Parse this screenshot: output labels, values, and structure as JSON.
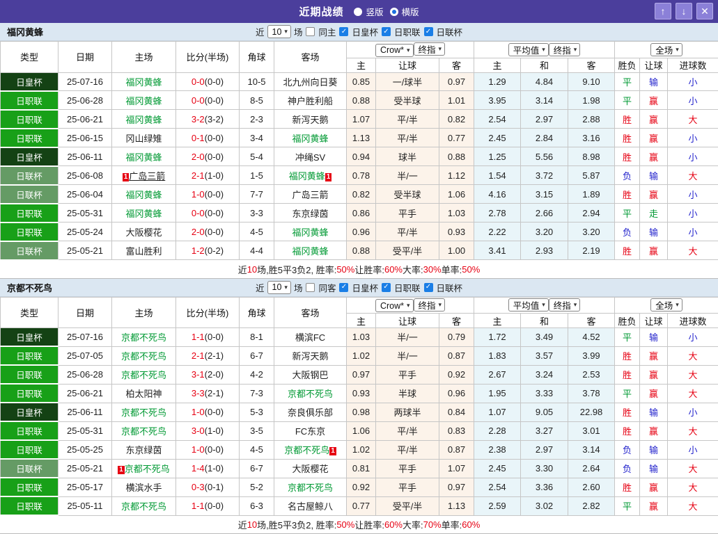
{
  "titlebar": {
    "title": "近期战绩",
    "vertical_label": "竖版",
    "horizontal_label": "横版",
    "selected_layout": "横版"
  },
  "icons": {
    "up": "↑",
    "down": "↓",
    "close": "✕",
    "check": "✓",
    "dropdown": "▾",
    "badge": "1"
  },
  "colors": {
    "titlebar_purple": "#4b3e9c",
    "cup_royal_green": "#144214",
    "league_green": "#18a018",
    "league_cup_green": "#659b65",
    "team_green": "#009933",
    "score_red": "#e60012",
    "lose_blue": "#2222cc"
  },
  "table_header": {
    "cols": [
      "类型",
      "日期",
      "主场",
      "比分(半场)",
      "角球",
      "客场"
    ],
    "group1_selects": [
      "Crow*",
      "终指"
    ],
    "group1_cols": [
      "主",
      "让球",
      "客"
    ],
    "group2_selects": [
      "平均值",
      "终指"
    ],
    "group2_cols": [
      "主",
      "和",
      "客"
    ],
    "group3_selects": [
      "全场"
    ],
    "group3_cols": [
      "胜负",
      "让球",
      "进球数"
    ]
  },
  "sections": [
    {
      "team": "福冈黄蜂",
      "filters": {
        "prefix": "近",
        "count": "10",
        "suffix": "场",
        "same_label": "同主",
        "same_checked": false,
        "cups": [
          {
            "label": "日皇杯",
            "checked": true
          },
          {
            "label": "日职联",
            "checked": true
          },
          {
            "label": "日联杯",
            "checked": true
          }
        ]
      },
      "rows": [
        {
          "type": "日皇杯",
          "tc": "royal",
          "date": "25-07-16",
          "home": "福冈黄蜂",
          "hg": true,
          "score": "0-0",
          "half": "(0-0)",
          "corner": "10-5",
          "away": "北九州向日葵",
          "o1": "0.85",
          "hcap": "一/球半",
          "o2": "0.97",
          "a1": "1.29",
          "a2": "4.84",
          "a3": "9.10",
          "r1": "平",
          "r1c": "g",
          "r2": "输",
          "r2c": "b",
          "r3": "小",
          "r3c": "b"
        },
        {
          "type": "日职联",
          "tc": "jl",
          "date": "25-06-28",
          "home": "福冈黄蜂",
          "hg": true,
          "score": "0-0",
          "half": "(0-0)",
          "corner": "8-5",
          "away": "神户胜利船",
          "o1": "0.88",
          "hcap": "受半球",
          "o2": "1.01",
          "a1": "3.95",
          "a2": "3.14",
          "a3": "1.98",
          "r1": "平",
          "r1c": "g",
          "r2": "赢",
          "r2c": "r",
          "r3": "小",
          "r3c": "b"
        },
        {
          "type": "日职联",
          "tc": "jl",
          "date": "25-06-21",
          "home": "福冈黄蜂",
          "hg": true,
          "score": "3-2",
          "half": "(3-2)",
          "corner": "2-3",
          "away": "新泻天鹅",
          "o1": "1.07",
          "hcap": "平/半",
          "o2": "0.82",
          "a1": "2.54",
          "a2": "2.97",
          "a3": "2.88",
          "r1": "胜",
          "r1c": "r",
          "r2": "赢",
          "r2c": "r",
          "r3": "大",
          "r3c": "r"
        },
        {
          "type": "日职联",
          "tc": "jl",
          "date": "25-06-15",
          "home": "冈山绿雉",
          "score": "0-1",
          "half": "(0-0)",
          "corner": "3-4",
          "away": "福冈黄蜂",
          "ag": true,
          "o1": "1.13",
          "hcap": "平/半",
          "o2": "0.77",
          "a1": "2.45",
          "a2": "2.84",
          "a3": "3.16",
          "r1": "胜",
          "r1c": "r",
          "r2": "赢",
          "r2c": "r",
          "r3": "小",
          "r3c": "b"
        },
        {
          "type": "日皇杯",
          "tc": "royal",
          "date": "25-06-11",
          "home": "福冈黄蜂",
          "hg": true,
          "score": "2-0",
          "half": "(0-0)",
          "corner": "5-4",
          "away": "冲绳SV",
          "o1": "0.94",
          "hcap": "球半",
          "o2": "0.88",
          "a1": "1.25",
          "a2": "5.56",
          "a3": "8.98",
          "r1": "胜",
          "r1c": "r",
          "r2": "赢",
          "r2c": "r",
          "r3": "小",
          "r3c": "b"
        },
        {
          "type": "日联杯",
          "tc": "lc",
          "date": "25-06-08",
          "home": "广岛三箭",
          "hb": true,
          "hu": true,
          "score": "2-1",
          "half": "(1-0)",
          "corner": "1-5",
          "away": "福冈黄蜂",
          "ag": true,
          "ab": true,
          "o1": "0.78",
          "hcap": "半/一",
          "o2": "1.12",
          "a1": "1.54",
          "a2": "3.72",
          "a3": "5.87",
          "r1": "负",
          "r1c": "b",
          "r2": "输",
          "r2c": "b",
          "r3": "大",
          "r3c": "r"
        },
        {
          "type": "日联杯",
          "tc": "lc",
          "date": "25-06-04",
          "home": "福冈黄蜂",
          "hg": true,
          "score": "1-0",
          "half": "(0-0)",
          "corner": "7-7",
          "away": "广岛三箭",
          "o1": "0.82",
          "hcap": "受半球",
          "o2": "1.06",
          "a1": "4.16",
          "a2": "3.15",
          "a3": "1.89",
          "r1": "胜",
          "r1c": "r",
          "r2": "赢",
          "r2c": "r",
          "r3": "小",
          "r3c": "b"
        },
        {
          "type": "日职联",
          "tc": "jl",
          "date": "25-05-31",
          "home": "福冈黄蜂",
          "hg": true,
          "score": "0-0",
          "half": "(0-0)",
          "corner": "3-3",
          "away": "东京绿茵",
          "o1": "0.86",
          "hcap": "平手",
          "o2": "1.03",
          "a1": "2.78",
          "a2": "2.66",
          "a3": "2.94",
          "r1": "平",
          "r1c": "g",
          "r2": "走",
          "r2c": "g",
          "r3": "小",
          "r3c": "b"
        },
        {
          "type": "日职联",
          "tc": "jl",
          "date": "25-05-24",
          "home": "大阪樱花",
          "score": "2-0",
          "half": "(0-0)",
          "corner": "4-5",
          "away": "福冈黄蜂",
          "ag": true,
          "o1": "0.96",
          "hcap": "平/半",
          "o2": "0.93",
          "a1": "2.22",
          "a2": "3.20",
          "a3": "3.20",
          "r1": "负",
          "r1c": "b",
          "r2": "输",
          "r2c": "b",
          "r3": "小",
          "r3c": "b"
        },
        {
          "type": "日联杯",
          "tc": "lc",
          "date": "25-05-21",
          "home": "富山胜利",
          "score": "1-2",
          "half": "(0-2)",
          "corner": "4-4",
          "away": "福冈黄蜂",
          "ag": true,
          "o1": "0.88",
          "hcap": "受平/半",
          "o2": "1.00",
          "a1": "3.41",
          "a2": "2.93",
          "a3": "2.19",
          "r1": "胜",
          "r1c": "r",
          "r2": "赢",
          "r2c": "r",
          "r3": "大",
          "r3c": "r"
        }
      ],
      "summary": [
        {
          "t": "近"
        },
        {
          "t": "10",
          "red": true
        },
        {
          "t": "场,胜5平3负2, 胜率:"
        },
        {
          "t": "50%",
          "red": true
        },
        {
          "t": " 让胜率:"
        },
        {
          "t": "60%",
          "red": true
        },
        {
          "t": " 大率:"
        },
        {
          "t": "30%",
          "red": true
        },
        {
          "t": " 单率:"
        },
        {
          "t": "50%",
          "red": true
        }
      ]
    },
    {
      "team": "京都不死鸟",
      "filters": {
        "prefix": "近",
        "count": "10",
        "suffix": "场",
        "same_label": "同客",
        "same_checked": false,
        "cups": [
          {
            "label": "日皇杯",
            "checked": true
          },
          {
            "label": "日职联",
            "checked": true
          },
          {
            "label": "日联杯",
            "checked": true
          }
        ]
      },
      "rows": [
        {
          "type": "日皇杯",
          "tc": "royal",
          "date": "25-07-16",
          "home": "京都不死鸟",
          "hg": true,
          "score": "1-1",
          "half": "(0-0)",
          "corner": "8-1",
          "away": "横滨FC",
          "o1": "1.03",
          "hcap": "半/一",
          "o2": "0.79",
          "a1": "1.72",
          "a2": "3.49",
          "a3": "4.52",
          "r1": "平",
          "r1c": "g",
          "r2": "输",
          "r2c": "b",
          "r3": "小",
          "r3c": "b"
        },
        {
          "type": "日职联",
          "tc": "jl",
          "date": "25-07-05",
          "home": "京都不死鸟",
          "hg": true,
          "score": "2-1",
          "half": "(2-1)",
          "corner": "6-7",
          "away": "新泻天鹅",
          "o1": "1.02",
          "hcap": "半/一",
          "o2": "0.87",
          "a1": "1.83",
          "a2": "3.57",
          "a3": "3.99",
          "r1": "胜",
          "r1c": "r",
          "r2": "赢",
          "r2c": "r",
          "r3": "大",
          "r3c": "r"
        },
        {
          "type": "日职联",
          "tc": "jl",
          "date": "25-06-28",
          "home": "京都不死鸟",
          "hg": true,
          "score": "3-1",
          "half": "(2-0)",
          "corner": "4-2",
          "away": "大阪钢巴",
          "o1": "0.97",
          "hcap": "平手",
          "o2": "0.92",
          "a1": "2.67",
          "a2": "3.24",
          "a3": "2.53",
          "r1": "胜",
          "r1c": "r",
          "r2": "赢",
          "r2c": "r",
          "r3": "大",
          "r3c": "r"
        },
        {
          "type": "日职联",
          "tc": "jl",
          "date": "25-06-21",
          "home": "柏太阳神",
          "score": "3-3",
          "half": "(2-1)",
          "corner": "7-3",
          "away": "京都不死鸟",
          "ag": true,
          "o1": "0.93",
          "hcap": "半球",
          "o2": "0.96",
          "a1": "1.95",
          "a2": "3.33",
          "a3": "3.78",
          "r1": "平",
          "r1c": "g",
          "r2": "赢",
          "r2c": "r",
          "r3": "大",
          "r3c": "r"
        },
        {
          "type": "日皇杯",
          "tc": "royal",
          "date": "25-06-11",
          "home": "京都不死鸟",
          "hg": true,
          "score": "1-0",
          "half": "(0-0)",
          "corner": "5-3",
          "away": "奈良俱乐部",
          "o1": "0.98",
          "hcap": "两球半",
          "o2": "0.84",
          "a1": "1.07",
          "a2": "9.05",
          "a3": "22.98",
          "r1": "胜",
          "r1c": "r",
          "r2": "输",
          "r2c": "b",
          "r3": "小",
          "r3c": "b"
        },
        {
          "type": "日职联",
          "tc": "jl",
          "date": "25-05-31",
          "home": "京都不死鸟",
          "hg": true,
          "score": "3-0",
          "half": "(1-0)",
          "corner": "3-5",
          "away": "FC东京",
          "o1": "1.06",
          "hcap": "平/半",
          "o2": "0.83",
          "a1": "2.28",
          "a2": "3.27",
          "a3": "3.01",
          "r1": "胜",
          "r1c": "r",
          "r2": "赢",
          "r2c": "r",
          "r3": "大",
          "r3c": "r"
        },
        {
          "type": "日职联",
          "tc": "jl",
          "date": "25-05-25",
          "home": "东京绿茵",
          "score": "1-0",
          "half": "(0-0)",
          "corner": "4-5",
          "away": "京都不死鸟",
          "ag": true,
          "ab": true,
          "o1": "1.02",
          "hcap": "平/半",
          "o2": "0.87",
          "a1": "2.38",
          "a2": "2.97",
          "a3": "3.14",
          "r1": "负",
          "r1c": "b",
          "r2": "输",
          "r2c": "b",
          "r3": "小",
          "r3c": "b"
        },
        {
          "type": "日联杯",
          "tc": "lc",
          "date": "25-05-21",
          "home": "京都不死鸟",
          "hg": true,
          "hb": true,
          "score": "1-4",
          "half": "(1-0)",
          "corner": "6-7",
          "away": "大阪樱花",
          "o1": "0.81",
          "hcap": "平手",
          "o2": "1.07",
          "a1": "2.45",
          "a2": "3.30",
          "a3": "2.64",
          "r1": "负",
          "r1c": "b",
          "r2": "输",
          "r2c": "b",
          "r3": "大",
          "r3c": "r"
        },
        {
          "type": "日职联",
          "tc": "jl",
          "date": "25-05-17",
          "home": "横滨水手",
          "score": "0-3",
          "half": "(0-1)",
          "corner": "5-2",
          "away": "京都不死鸟",
          "ag": true,
          "o1": "0.92",
          "hcap": "平手",
          "o2": "0.97",
          "a1": "2.54",
          "a2": "3.36",
          "a3": "2.60",
          "r1": "胜",
          "r1c": "r",
          "r2": "赢",
          "r2c": "r",
          "r3": "大",
          "r3c": "r"
        },
        {
          "type": "日职联",
          "tc": "jl",
          "date": "25-05-11",
          "home": "京都不死鸟",
          "hg": true,
          "score": "1-1",
          "half": "(0-0)",
          "corner": "6-3",
          "away": "名古屋鲸八",
          "o1": "0.77",
          "hcap": "受平/半",
          "o2": "1.13",
          "a1": "2.59",
          "a2": "3.02",
          "a3": "2.82",
          "r1": "平",
          "r1c": "g",
          "r2": "赢",
          "r2c": "r",
          "r3": "大",
          "r3c": "r"
        }
      ],
      "summary": [
        {
          "t": "近"
        },
        {
          "t": "10",
          "red": true
        },
        {
          "t": "场,胜5平3负2, 胜率:"
        },
        {
          "t": "50%",
          "red": true
        },
        {
          "t": " 让胜率:"
        },
        {
          "t": "60%",
          "red": true
        },
        {
          "t": " 大率:"
        },
        {
          "t": "70%",
          "red": true
        },
        {
          "t": " 单率:"
        },
        {
          "t": "60%",
          "red": true
        }
      ]
    }
  ]
}
